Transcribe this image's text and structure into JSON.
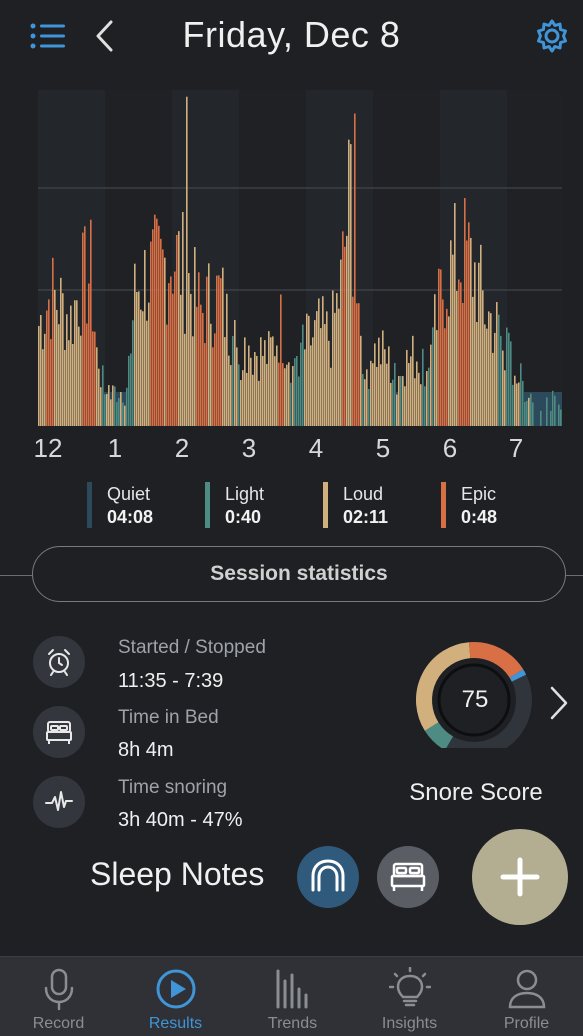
{
  "header": {
    "title": "Friday, Dec 8",
    "menu_icon": "list-menu-icon",
    "back_icon": "chevron-left-icon",
    "settings_icon": "gear-icon"
  },
  "chart_data": {
    "type": "bar",
    "x_ticks": [
      "12",
      "1",
      "2",
      "3",
      "4",
      "5",
      "6",
      "7"
    ],
    "series": [
      {
        "name": "Quiet",
        "color": "#2d4a5c"
      },
      {
        "name": "Light",
        "color": "#4e8b83"
      },
      {
        "name": "Loud",
        "color": "#d2b07e"
      },
      {
        "name": "Epic",
        "color": "#d96f45"
      }
    ],
    "grid": true
  },
  "legend": [
    {
      "name": "Quiet",
      "value": "04:08",
      "color": "#2d4a5c"
    },
    {
      "name": "Light",
      "value": "0:40",
      "color": "#4e8b83"
    },
    {
      "name": "Loud",
      "value": "02:11",
      "color": "#d2b07e"
    },
    {
      "name": "Epic",
      "value": "0:48",
      "color": "#d96f45"
    }
  ],
  "session_button": "Session statistics",
  "stats": [
    {
      "label": "Started / Stopped",
      "value": "11:35 - 7:39",
      "icon": "alarm-clock-icon"
    },
    {
      "label": "Time in Bed",
      "value": "8h 4m",
      "icon": "bed-icon"
    },
    {
      "label": "Time snoring",
      "value": "3h 40m - 47%",
      "icon": "pulse-icon"
    }
  ],
  "snore_score": {
    "value": "75",
    "label": "Snore Score",
    "colors": {
      "loud": "#d2b07e",
      "epic": "#d96f45",
      "light": "#4e8b83",
      "marker": "#3f95d8",
      "track": "#30353b"
    }
  },
  "sleep_notes": {
    "label": "Sleep Notes",
    "mouthguard_icon": "mouthguard-icon",
    "bed_icon": "bed-icon",
    "add_icon": "plus-icon"
  },
  "tabs": [
    {
      "label": "Record",
      "icon": "microphone-icon",
      "active": false
    },
    {
      "label": "Results",
      "icon": "play-circle-icon",
      "active": true
    },
    {
      "label": "Trends",
      "icon": "bar-trends-icon",
      "active": false
    },
    {
      "label": "Insights",
      "icon": "lightbulb-icon",
      "active": false
    },
    {
      "label": "Profile",
      "icon": "user-icon",
      "active": false
    }
  ],
  "accent_color": "#3f95d8"
}
